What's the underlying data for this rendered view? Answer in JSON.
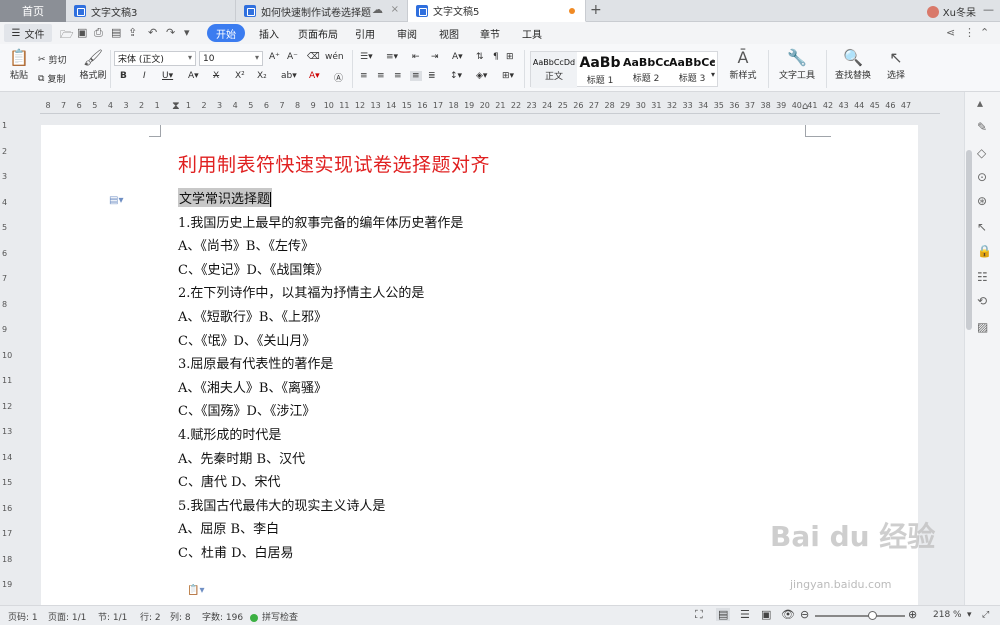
{
  "tabs": {
    "home": "首页",
    "items": [
      {
        "label": "文字文稿3"
      },
      {
        "label": "如何快速制作试卷选择题"
      },
      {
        "label": "文字文稿5"
      }
    ],
    "new_tab": "+",
    "user_name": "Xu冬呆"
  },
  "menu": {
    "file": "文件",
    "items": [
      "开始",
      "插入",
      "页面布局",
      "引用",
      "审阅",
      "视图",
      "章节",
      "工具"
    ]
  },
  "ribbon": {
    "paste": "粘贴",
    "cut": "剪切",
    "copy": "复制",
    "format_painter": "格式刷",
    "font_name": "宋体 (正文)",
    "font_size": "10",
    "styles": [
      {
        "preview": "AaBbCcDd",
        "name": "正文"
      },
      {
        "preview": "AaBb",
        "name": "标题 1"
      },
      {
        "preview": "AaBbCc",
        "name": "标题 2"
      },
      {
        "preview": "AaBbCc",
        "name": "标题 3"
      }
    ],
    "new_style": "新样式",
    "text_tools": "文字工具",
    "find_replace": "查找替换",
    "select": "选择"
  },
  "ruler": {
    "ticks": [
      "8",
      "7",
      "6",
      "5",
      "4",
      "3",
      "2",
      "1",
      "",
      "1",
      "2",
      "3",
      "4",
      "5",
      "6",
      "7",
      "8",
      "9",
      "10",
      "11",
      "12",
      "13",
      "14",
      "15",
      "16",
      "17",
      "18",
      "19",
      "20",
      "21",
      "22",
      "23",
      "24",
      "25",
      "26",
      "27",
      "28",
      "29",
      "30",
      "31",
      "32",
      "33",
      "34",
      "35",
      "36",
      "37",
      "38",
      "39",
      "40",
      "41",
      "42",
      "43",
      "44",
      "45",
      "46",
      "47"
    ],
    "vticks": [
      "1",
      "2",
      "3",
      "4",
      "5",
      "6",
      "7",
      "8",
      "9",
      "10",
      "11",
      "12",
      "13",
      "14",
      "15",
      "16",
      "17",
      "18",
      "19"
    ]
  },
  "document": {
    "title": "利用制表符快速实现试卷选择题对齐",
    "lines": [
      "文学常识选择题",
      "1.我国历史上最早的叙事完备的编年体历史著作是",
      "A、《尚书》B、《左传》",
      "C、《史记》D、《战国策》",
      "2.在下列诗作中，以其福为抒情主人公的是",
      "A、《短歌行》B、《上邪》",
      "C、《氓》D、《关山月》",
      "3.屈原最有代表性的著作是",
      "A、《湘夫人》B、《离骚》",
      "C、《国殇》D、《涉江》",
      "4.赋形成的时代是",
      "A、先秦时期 B、汉代",
      "C、唐代 D、宋代",
      "5.我国古代最伟大的现实主义诗人是",
      "A、屈原 B、李白",
      "C、杜甫 D、白居易"
    ]
  },
  "watermark": {
    "main": "Bai du 经验",
    "sub": "jingyan.baidu.com"
  },
  "status": {
    "page_num": "页码: 1",
    "pages": "页面: 1/1",
    "section": "节: 1/1",
    "row": "行: 2",
    "col": "列: 8",
    "words": "字数: 196",
    "spell": "拼写检查",
    "zoom": "218 %"
  },
  "colors": {
    "accent": "#3b7cf0",
    "title_red": "#e02020",
    "modified_dot": "#f08a24"
  }
}
